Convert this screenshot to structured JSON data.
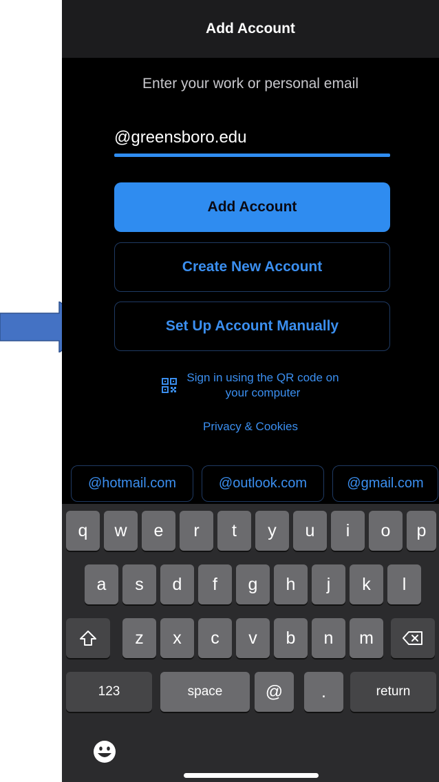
{
  "header": {
    "title": "Add Account"
  },
  "form": {
    "prompt": "Enter your work or personal email",
    "email_value": "@greensboro.edu"
  },
  "buttons": {
    "add_account": "Add Account",
    "create_new": "Create New Account",
    "setup_manual": "Set Up Account Manually"
  },
  "qr": {
    "line1": "Sign in using the QR code on",
    "line2": "your computer",
    "icon": "qr-code-icon"
  },
  "privacy": "Privacy & Cookies",
  "domain_chips": [
    "@hotmail.com",
    "@outlook.com",
    "@gmail.com"
  ],
  "keyboard": {
    "row1": [
      "q",
      "w",
      "e",
      "r",
      "t",
      "y",
      "u",
      "i",
      "o",
      "p"
    ],
    "row2": [
      "a",
      "s",
      "d",
      "f",
      "g",
      "h",
      "j",
      "k",
      "l"
    ],
    "row3": [
      "z",
      "x",
      "c",
      "v",
      "b",
      "n",
      "m"
    ],
    "numbers": "123",
    "space": "space",
    "at": "@",
    "dot": ".",
    "return": "return",
    "shift_icon": "shift-icon",
    "delete_icon": "backspace-icon",
    "emoji_icon": "emoji-icon"
  },
  "colors": {
    "accent": "#2f8cf0",
    "background": "#000000",
    "arrow": "#4472c4"
  }
}
